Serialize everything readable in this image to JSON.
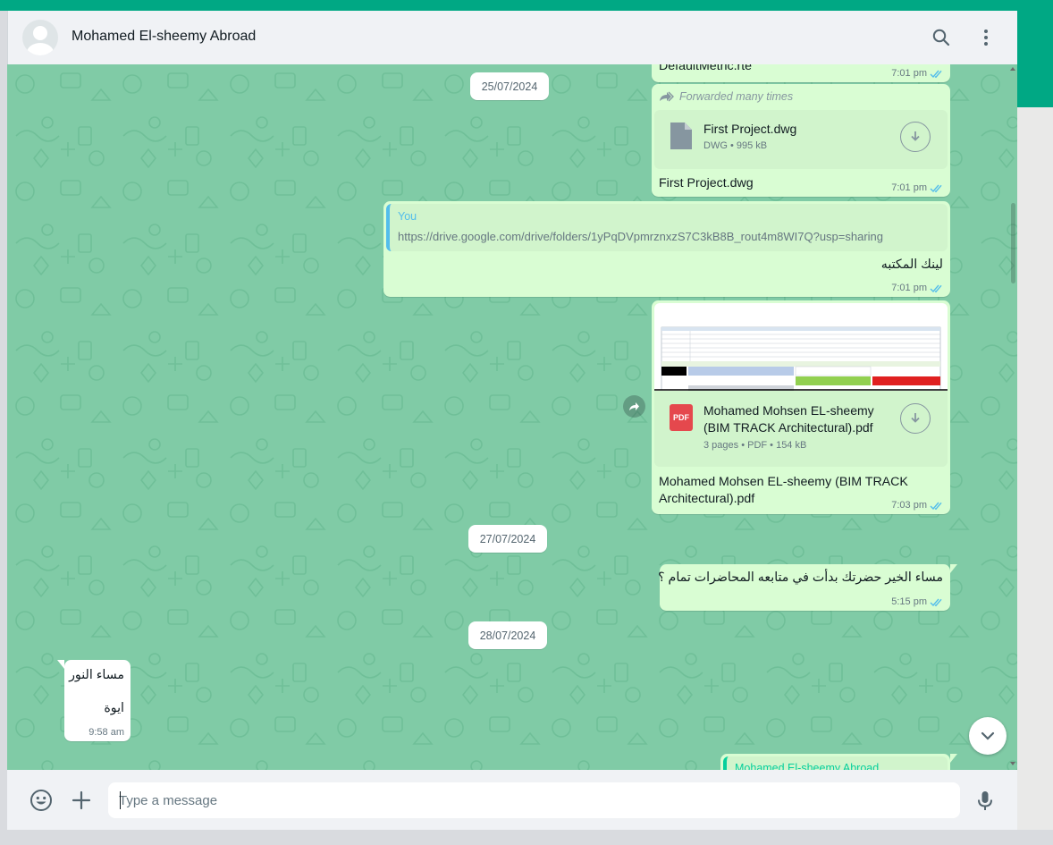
{
  "header": {
    "contact_name": "Mohamed El-sheemy Abroad",
    "search_icon": "search-icon",
    "menu_icon": "more-vertical-icon"
  },
  "colors": {
    "accent": "#00a884",
    "chat_bg": "#80cba6",
    "outgoing_bubble": "#d9fdd3",
    "incoming_bubble": "#ffffff",
    "read_ticks": "#53bdeb",
    "pdf_red": "#e5484d"
  },
  "messages": {
    "m0": {
      "text": "DefaultMetric.rte",
      "time": "7:01 pm"
    },
    "date1": "25/07/2024",
    "m1": {
      "forwarded_label": "Forwarded many times",
      "file_name": "First Project.dwg",
      "file_meta": "DWG • 995 kB",
      "caption": "First Project.dwg",
      "time": "7:01 pm"
    },
    "m2": {
      "quote_author": "You",
      "quote_text": "https://drive.google.com/drive/folders/1yPqDVpmrznxzS7C3kB8B_rout4m8WI7Q?usp=sharing",
      "text": "لينك المكتبه",
      "time": "7:01 pm"
    },
    "m3": {
      "file_name_line1": "Mohamed Mohsen EL-sheemy",
      "file_name_line2": "(BIM TRACK Architectural).pdf",
      "file_meta": "3 pages • PDF • 154 kB",
      "pdf_badge": "PDF",
      "caption_line1": "Mohamed Mohsen EL-sheemy (BIM TRACK",
      "caption_line2": "Architectural).pdf",
      "time": "7:03 pm"
    },
    "date2": "27/07/2024",
    "m4": {
      "text": "مساء الخير حضرتك بدأت في متابعه المحاضرات تمام ؟",
      "time": "5:15 pm"
    },
    "date3": "28/07/2024",
    "m5": {
      "line1": "مساء النور",
      "line2": "ايوة",
      "time": "9:58 am"
    },
    "m6": {
      "quote_author": "Mohamed El-sheemy Abroad"
    }
  },
  "composer": {
    "placeholder": "Type a message",
    "emoji_icon": "emoji-icon",
    "attach_icon": "plus-icon",
    "mic_icon": "microphone-icon"
  }
}
